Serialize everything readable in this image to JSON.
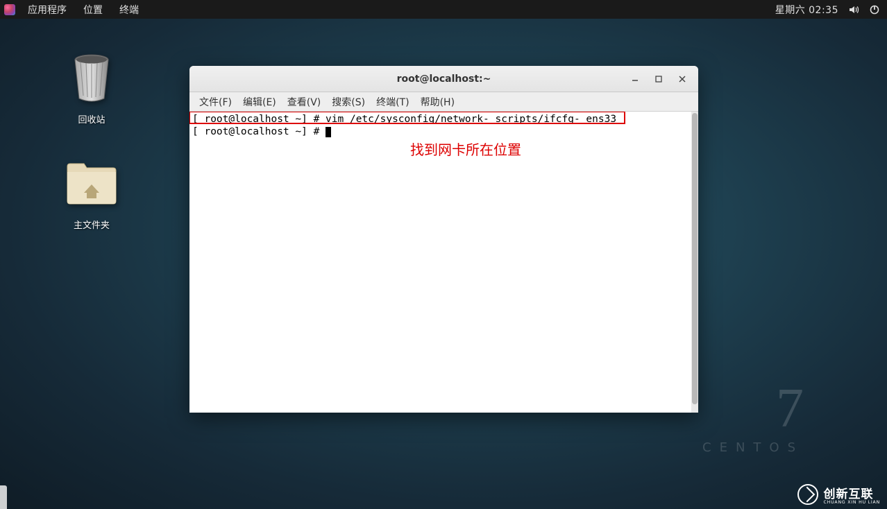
{
  "panel": {
    "menu": {
      "applications": "应用程序",
      "places": "位置",
      "terminal": "终端"
    },
    "clock": "星期六 02:35"
  },
  "desktop": {
    "trash": "回收站",
    "home": "主文件夹"
  },
  "window": {
    "title": "root@localhost:~",
    "menu": {
      "file": "文件(F)",
      "edit": "编辑(E)",
      "view": "查看(V)",
      "search": "搜索(S)",
      "terminal": "终端(T)",
      "help": "帮助(H)"
    },
    "lines": {
      "l1": "[ root@localhost ~] # vim /etc/sysconfig/network- scripts/ifcfg- ens33",
      "l2": "[ root@localhost ~] # "
    },
    "annotation": "找到网卡所在位置"
  },
  "centos": {
    "num": "7",
    "name": "CENTOS"
  },
  "brand": {
    "cn": "创新互联",
    "en": "CHUANG XIN HU LIAN"
  }
}
